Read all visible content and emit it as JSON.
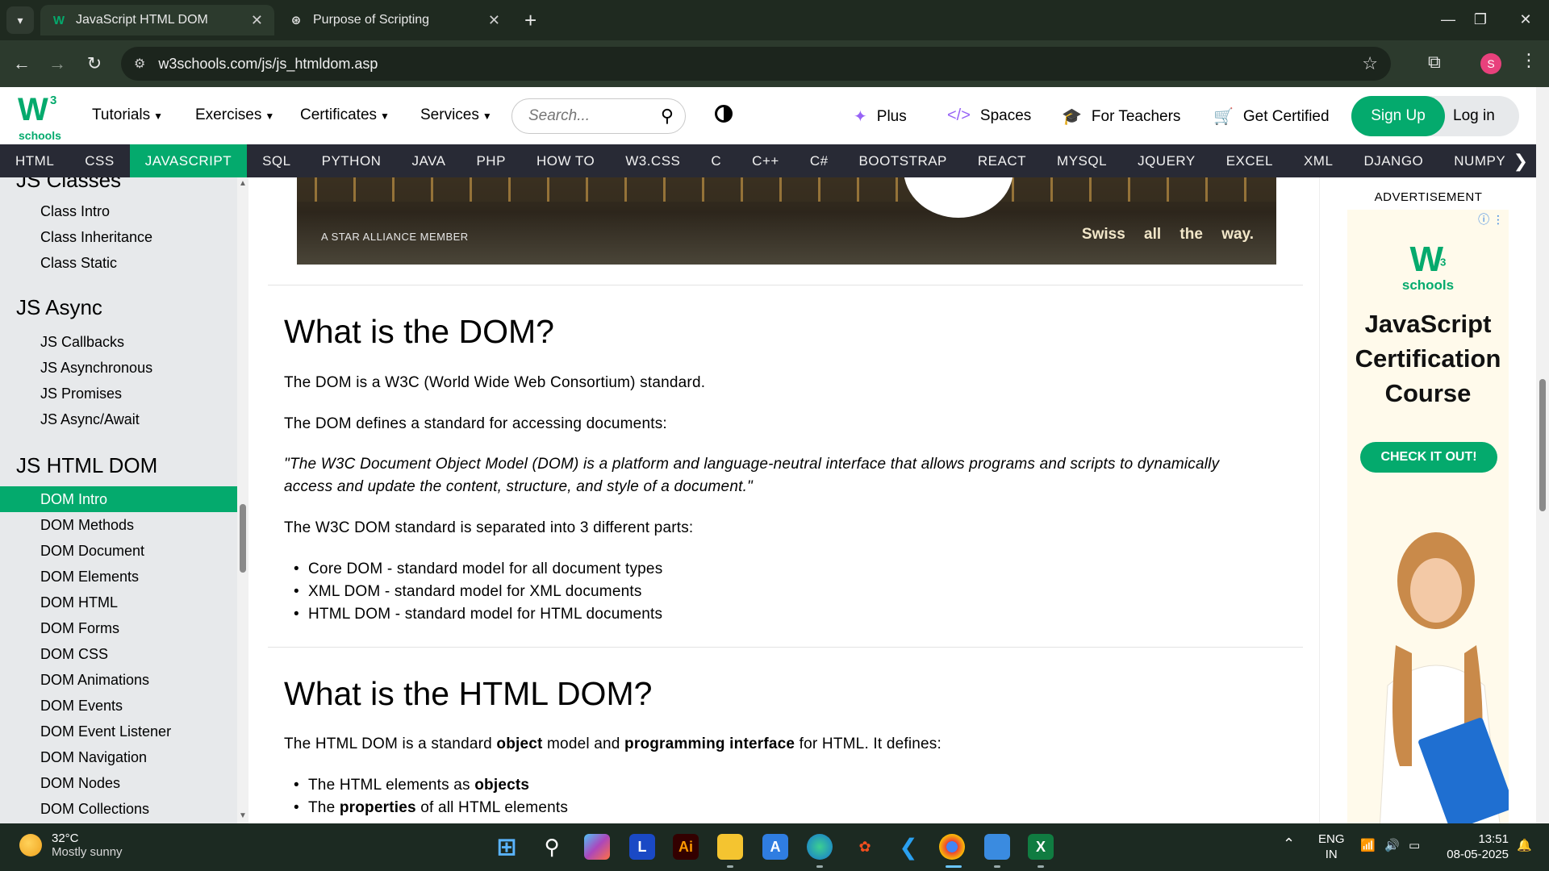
{
  "browser": {
    "tabs": [
      {
        "title": "JavaScript HTML DOM",
        "favicon": "w3schools-favicon",
        "active": true
      },
      {
        "title": "Purpose of Scripting",
        "favicon": "openai-favicon",
        "active": false
      }
    ],
    "url": "w3schools.com/js/js_htmldom.asp",
    "profile_initial": "S"
  },
  "header": {
    "logo_mark": "W",
    "logo_sup": "3",
    "logo_text": "schools",
    "menus": [
      "Tutorials",
      "Exercises",
      "Certificates",
      "Services"
    ],
    "search_placeholder": "Search...",
    "links": [
      "Plus",
      "Spaces",
      "For Teachers",
      "Get Certified"
    ],
    "signup": "Sign Up",
    "login": "Log in"
  },
  "topnav": [
    "HTML",
    "CSS",
    "JAVASCRIPT",
    "SQL",
    "PYTHON",
    "JAVA",
    "PHP",
    "HOW TO",
    "W3.CSS",
    "C",
    "C++",
    "C#",
    "BOOTSTRAP",
    "REACT",
    "MYSQL",
    "JQUERY",
    "EXCEL",
    "XML",
    "DJANGO",
    "NUMPY"
  ],
  "topnav_active": "JAVASCRIPT",
  "sidebar": {
    "sections": [
      {
        "heading": "JS Classes",
        "items": [
          "Class Intro",
          "Class Inheritance",
          "Class Static"
        ]
      },
      {
        "heading": "JS Async",
        "items": [
          "JS Callbacks",
          "JS Asynchronous",
          "JS Promises",
          "JS Async/Await"
        ]
      },
      {
        "heading": "JS HTML DOM",
        "items": [
          "DOM Intro",
          "DOM Methods",
          "DOM Document",
          "DOM Elements",
          "DOM HTML",
          "DOM Forms",
          "DOM CSS",
          "DOM Animations",
          "DOM Events",
          "DOM Event Listener",
          "DOM Navigation",
          "DOM Nodes",
          "DOM Collections"
        ]
      }
    ],
    "active_item": "DOM Intro"
  },
  "banner": {
    "member": "A STAR ALLIANCE MEMBER",
    "tagline": "Swiss all the way."
  },
  "content": {
    "h1_dom": "What is the DOM?",
    "p1": "The DOM is a W3C (World Wide Web Consortium) standard.",
    "p2": "The DOM defines a standard for accessing documents:",
    "quote": "\"The W3C Document Object Model (DOM) is a platform and language-neutral interface that allows programs and scripts to dynamically access and update the content, structure, and style of a document.\"",
    "p3": "The W3C DOM standard is separated into 3 different parts:",
    "parts": [
      "Core DOM - standard model for all document types",
      "XML DOM - standard model for XML documents",
      "HTML DOM - standard model for HTML documents"
    ],
    "h1_html_dom": "What is the HTML DOM?",
    "p4_a": "The HTML DOM is a standard ",
    "p4_b": "object",
    "p4_c": " model and ",
    "p4_d": "programming interface",
    "p4_e": " for HTML. It defines:",
    "def1_a": "The HTML elements as ",
    "def1_b": "objects",
    "def2_a": "The ",
    "def2_b": "properties",
    "def2_c": " of all HTML elements"
  },
  "ad": {
    "label": "ADVERTISEMENT",
    "logo_mark": "W",
    "logo_sup": "3",
    "logo_text": "schools",
    "title": "JavaScript Certification Course",
    "cta": "CHECK IT OUT!"
  },
  "taskbar": {
    "temp": "32°C",
    "weather": "Mostly sunny",
    "lang1": "ENG",
    "lang2": "IN",
    "time": "13:51",
    "date": "08-05-2025"
  },
  "colors": {
    "brand_green": "#04aa6d",
    "topnav_bg": "#282a35",
    "sidebar_bg": "#e7e9eb",
    "browser_bg": "#2c3a2d"
  }
}
